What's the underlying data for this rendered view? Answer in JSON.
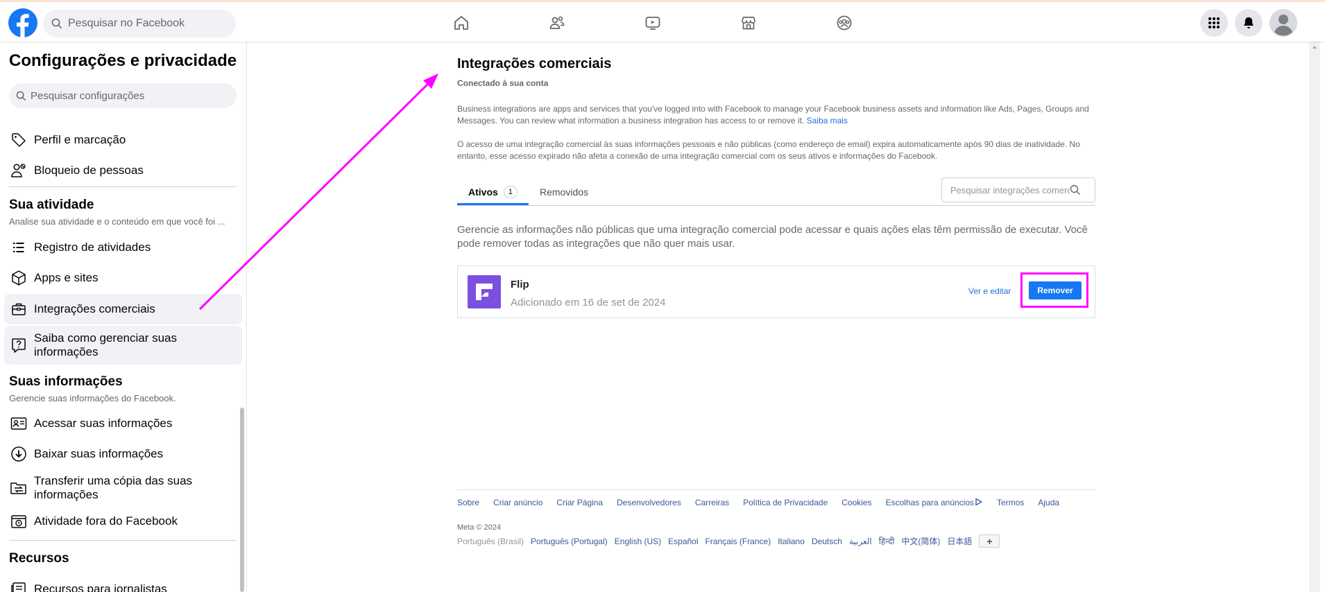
{
  "topbar": {
    "search_placeholder": "Pesquisar no Facebook",
    "nav_icons": [
      "home-icon",
      "friends-icon",
      "video-icon",
      "marketplace-icon",
      "groups-icon"
    ],
    "right_icons": [
      "menu-grid-icon",
      "notifications-bell-icon",
      "profile-avatar"
    ]
  },
  "sidebar": {
    "title": "Configurações e privacidade",
    "search_placeholder": "Pesquisar configurações",
    "items_top": [
      {
        "label": "Perfil e marcação",
        "icon": "tag-icon"
      },
      {
        "label": "Bloqueio de pessoas",
        "icon": "block-user-icon"
      }
    ],
    "section_activity": {
      "title": "Sua atividade",
      "subtitle": "Analise sua atividade e o conteúdo em que você foi ...",
      "items": [
        {
          "label": "Registro de atividades",
          "icon": "list-icon"
        },
        {
          "label": "Apps e sites",
          "icon": "cube-icon"
        },
        {
          "label": "Integrações comerciais",
          "icon": "briefcase-icon",
          "active": true
        },
        {
          "label": "Saiba como gerenciar suas informações",
          "icon": "question-bubble-icon"
        }
      ]
    },
    "section_info": {
      "title": "Suas informações",
      "subtitle": "Gerencie suas informações do Facebook.",
      "items": [
        {
          "label": "Acessar suas informações",
          "icon": "id-card-icon"
        },
        {
          "label": "Baixar suas informações",
          "icon": "download-icon"
        },
        {
          "label": "Transferir uma cópia das suas informações",
          "icon": "transfer-folder-icon"
        },
        {
          "label": "Atividade fora do Facebook",
          "icon": "off-facebook-activity-icon"
        }
      ]
    },
    "section_resources": {
      "title": "Recursos",
      "items": [
        {
          "label": "Recursos para jornalistas",
          "icon": "newspaper-icon"
        }
      ]
    }
  },
  "main": {
    "title": "Integrações comerciais",
    "subtitle": "Conectado à sua conta",
    "desc1": "Business integrations are apps and services that you've logged into with Facebook to manage your Facebook business assets and information like Ads, Pages, Groups and Messages. You can review what information a business integration has access to or remove it.",
    "desc1_link": "Saiba mais",
    "desc2": "O acesso de uma integração comercial às suas informações pessoais e não públicas (como endereço de email) expira automaticamente após 90 dias de inatividade. No entanto, esse acesso expirado não afeta a conexão de uma integração comercial com os seus ativos e informações do Facebook.",
    "tabs": [
      {
        "label": "Ativos",
        "badge": "1",
        "active": true
      },
      {
        "label": "Removidos"
      }
    ],
    "integration_search_placeholder": "Pesquisar integrações comerciais",
    "manage_text": "Gerencie as informações não públicas que uma integração comercial pode acessar e quais ações elas têm permissão de executar. Você pode remover todas as integrações que não quer mais usar.",
    "integration": {
      "name": "Flip",
      "added": "Adicionado em 16 de set de 2024",
      "view_edit": "Ver e editar",
      "remove": "Remover"
    }
  },
  "footer": {
    "links": [
      "Sobre",
      "Criar anúncio",
      "Criar Página",
      "Desenvolvedores",
      "Carreiras",
      "Política de Privacidade",
      "Cookies",
      "Escolhas para anúncios",
      "Termos",
      "Ajuda"
    ],
    "copyright": "Meta © 2024",
    "current_language": "Português (Brasil)",
    "languages": [
      "Português (Portugal)",
      "English (US)",
      "Español",
      "Français (France)",
      "Italiano",
      "Deutsch",
      "العربية",
      "हिन्दी",
      "中文(简体)",
      "日本語"
    ],
    "more_languages": "+"
  },
  "colors": {
    "brand": "#1877f2",
    "annotation": "#ff00ff",
    "app_logo": "#7b4fe0"
  }
}
